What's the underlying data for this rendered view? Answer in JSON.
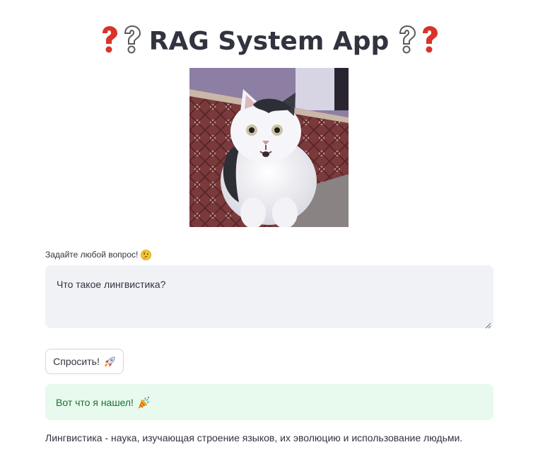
{
  "header": {
    "title": "RAG System App",
    "left_icons": [
      "red-question-mark-icon",
      "white-question-mark-icon"
    ],
    "right_icons": [
      "white-question-mark-icon",
      "red-question-mark-icon"
    ]
  },
  "image": {
    "subject": "cat-photo"
  },
  "question": {
    "label": "Задайте любой вопрос!",
    "label_icon": "thinking-face-icon",
    "value": "Что такое лингвистика?"
  },
  "ask_button": {
    "label": "Спросить!",
    "icon": "rocket-icon"
  },
  "result": {
    "status_text": "Вот что я нашел!",
    "status_icon": "party-popper-icon",
    "answer": "Лингвистика - наука, изучающая строение языков, их эволюцию и использование людьми."
  },
  "colors": {
    "text": "#31333f",
    "input_bg": "#f0f2f6",
    "success_bg": "#e8f9ee",
    "success_text": "#177233",
    "button_border": "#d5d6da",
    "question_red": "#d8342a"
  }
}
